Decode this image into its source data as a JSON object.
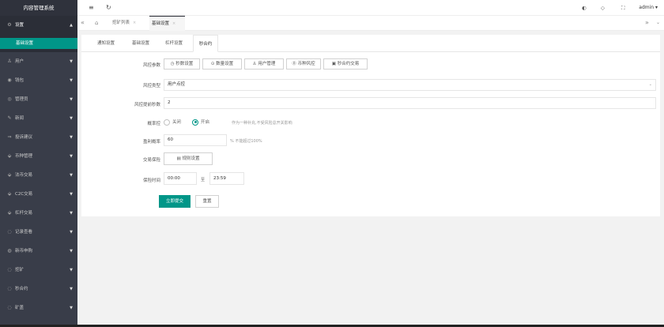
{
  "sidebar": {
    "brand": "内容管理系统",
    "settings_label": "设置",
    "sub_active": "基础设置",
    "items": [
      {
        "label": "用户",
        "icon": "user-icon"
      },
      {
        "label": "钱包",
        "icon": "wallet-icon"
      },
      {
        "label": "管理员",
        "icon": "admin-icon"
      },
      {
        "label": "新闻",
        "icon": "news-icon"
      },
      {
        "label": "投诉建议",
        "icon": "feedback-icon"
      },
      {
        "label": "币种管理",
        "icon": "coin-icon"
      },
      {
        "label": "法币交易",
        "icon": "fiat-icon"
      },
      {
        "label": "C2C交易",
        "icon": "c2c-icon"
      },
      {
        "label": "杠杆交易",
        "icon": "leverage-icon"
      },
      {
        "label": "记录查看",
        "icon": "record-icon"
      },
      {
        "label": "新币申购",
        "icon": "newcoin-icon"
      },
      {
        "label": "挖矿",
        "icon": "mining-icon"
      },
      {
        "label": "秒合约",
        "icon": "contract-icon"
      },
      {
        "label": "矿盖",
        "icon": "pool-icon"
      }
    ]
  },
  "topbar": {
    "admin_label": "admin"
  },
  "page_tabs": [
    {
      "label": "挖矿列表"
    },
    {
      "label": "基础设置"
    }
  ],
  "tabs": [
    "通知设置",
    "基础设置",
    "杠杆设置",
    "秒合约"
  ],
  "form": {
    "risk_params_label": "风控参数",
    "risk_buttons": [
      {
        "label": "秒数设置",
        "icon": "clock-icon"
      },
      {
        "label": "数量设置",
        "icon": "amount-icon"
      },
      {
        "label": "用户管理",
        "icon": "user-icon"
      },
      {
        "label": "币种风控",
        "icon": "coin-risk-icon"
      },
      {
        "label": "秒合约交易",
        "icon": "trade-icon"
      }
    ],
    "risk_type_label": "风控类型",
    "risk_type_value": "用户点控",
    "risk_delay_label": "风控提前秒数",
    "risk_delay_value": "2",
    "odds_label": "概率控",
    "radio_off": "关闭",
    "radio_on": "开启",
    "odds_hint": "作为一种补充,不受风险总开关影响",
    "profit_rate_label": "盈利概率",
    "profit_rate_value": "60",
    "profit_rate_hint": "%  不能超过100%",
    "trade_protect_label": "交易保险",
    "rule_button": "规则设置",
    "protect_time_label": "保险时间",
    "time_start": "00:00",
    "time_sep": "至",
    "time_end": "23:59",
    "submit_label": "立即提交",
    "reset_label": "重置"
  }
}
